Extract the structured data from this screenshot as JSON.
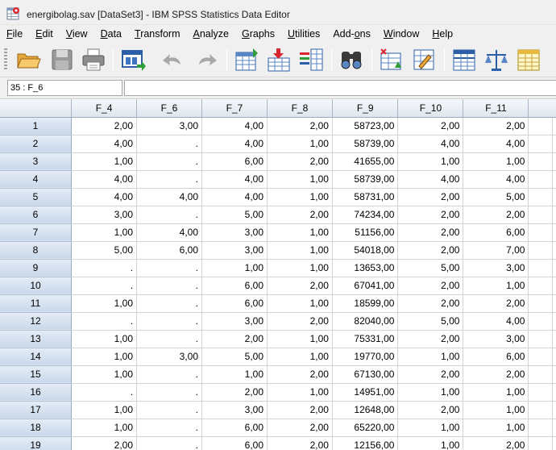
{
  "window": {
    "title": "energibolag.sav [DataSet3] - IBM SPSS Statistics Data Editor"
  },
  "menu": [
    {
      "label": "File",
      "u": "F",
      "rest": "ile"
    },
    {
      "label": "Edit",
      "u": "E",
      "rest": "dit"
    },
    {
      "label": "View",
      "u": "V",
      "rest": "iew"
    },
    {
      "label": "Data",
      "u": "D",
      "rest": "ata"
    },
    {
      "label": "Transform",
      "u": "T",
      "rest": "ransform"
    },
    {
      "label": "Analyze",
      "u": "A",
      "rest": "nalyze"
    },
    {
      "label": "Graphs",
      "u": "G",
      "rest": "raphs"
    },
    {
      "label": "Utilities",
      "u": "U",
      "rest": "tilities"
    },
    {
      "label": "Add-ons",
      "pre": "Add-",
      "u": "o",
      "rest": "ns"
    },
    {
      "label": "Window",
      "u": "W",
      "rest": "indow"
    },
    {
      "label": "Help",
      "u": "H",
      "rest": "elp"
    }
  ],
  "toolbar": [
    {
      "name": "open-folder-icon"
    },
    {
      "name": "save-icon"
    },
    {
      "name": "print-icon"
    },
    {
      "name": "dialog-recall-icon"
    },
    {
      "name": "undo-icon"
    },
    {
      "name": "redo-icon"
    },
    {
      "name": "goto-case-icon"
    },
    {
      "name": "goto-variable-icon"
    },
    {
      "name": "variables-icon"
    },
    {
      "name": "find-icon"
    },
    {
      "name": "insert-cases-icon"
    },
    {
      "name": "insert-variable-icon"
    },
    {
      "name": "split-file-icon"
    },
    {
      "name": "weight-cases-icon"
    },
    {
      "name": "select-cases-icon"
    }
  ],
  "cell_editor": {
    "reference": "35 : F_6",
    "value": ""
  },
  "grid": {
    "columns": [
      "F_4",
      "F_6",
      "F_7",
      "F_8",
      "F_9",
      "F_10",
      "F_11"
    ],
    "rows": [
      {
        "n": "1",
        "cells": [
          "2,00",
          "3,00",
          "4,00",
          "2,00",
          "58723,00",
          "2,00",
          "2,00"
        ]
      },
      {
        "n": "2",
        "cells": [
          "4,00",
          ".",
          "4,00",
          "1,00",
          "58739,00",
          "4,00",
          "4,00"
        ]
      },
      {
        "n": "3",
        "cells": [
          "1,00",
          ".",
          "6,00",
          "2,00",
          "41655,00",
          "1,00",
          "1,00"
        ]
      },
      {
        "n": "4",
        "cells": [
          "4,00",
          ".",
          "4,00",
          "1,00",
          "58739,00",
          "4,00",
          "4,00"
        ]
      },
      {
        "n": "5",
        "cells": [
          "4,00",
          "4,00",
          "4,00",
          "1,00",
          "58731,00",
          "2,00",
          "5,00"
        ]
      },
      {
        "n": "6",
        "cells": [
          "3,00",
          ".",
          "5,00",
          "2,00",
          "74234,00",
          "2,00",
          "2,00"
        ]
      },
      {
        "n": "7",
        "cells": [
          "1,00",
          "4,00",
          "3,00",
          "1,00",
          "51156,00",
          "2,00",
          "6,00"
        ]
      },
      {
        "n": "8",
        "cells": [
          "5,00",
          "6,00",
          "3,00",
          "1,00",
          "54018,00",
          "2,00",
          "7,00"
        ]
      },
      {
        "n": "9",
        "cells": [
          ".",
          ".",
          "1,00",
          "1,00",
          "13653,00",
          "5,00",
          "3,00"
        ]
      },
      {
        "n": "10",
        "cells": [
          ".",
          ".",
          "6,00",
          "2,00",
          "67041,00",
          "2,00",
          "1,00"
        ]
      },
      {
        "n": "11",
        "cells": [
          "1,00",
          ".",
          "6,00",
          "1,00",
          "18599,00",
          "2,00",
          "2,00"
        ]
      },
      {
        "n": "12",
        "cells": [
          ".",
          ".",
          "3,00",
          "2,00",
          "82040,00",
          "5,00",
          "4,00"
        ]
      },
      {
        "n": "13",
        "cells": [
          "1,00",
          ".",
          "2,00",
          "1,00",
          "75331,00",
          "2,00",
          "3,00"
        ]
      },
      {
        "n": "14",
        "cells": [
          "1,00",
          "3,00",
          "5,00",
          "1,00",
          "19770,00",
          "1,00",
          "6,00"
        ]
      },
      {
        "n": "15",
        "cells": [
          "1,00",
          ".",
          "1,00",
          "2,00",
          "67130,00",
          "2,00",
          "2,00"
        ]
      },
      {
        "n": "16",
        "cells": [
          ".",
          ".",
          "2,00",
          "1,00",
          "14951,00",
          "1,00",
          "1,00"
        ]
      },
      {
        "n": "17",
        "cells": [
          "1,00",
          ".",
          "3,00",
          "2,00",
          "12648,00",
          "2,00",
          "1,00"
        ]
      },
      {
        "n": "18",
        "cells": [
          "1,00",
          ".",
          "6,00",
          "2,00",
          "65220,00",
          "1,00",
          "1,00"
        ]
      },
      {
        "n": "19",
        "cells": [
          "2,00",
          ".",
          "6,00",
          "2,00",
          "12156,00",
          "1,00",
          "2,00"
        ]
      }
    ]
  }
}
